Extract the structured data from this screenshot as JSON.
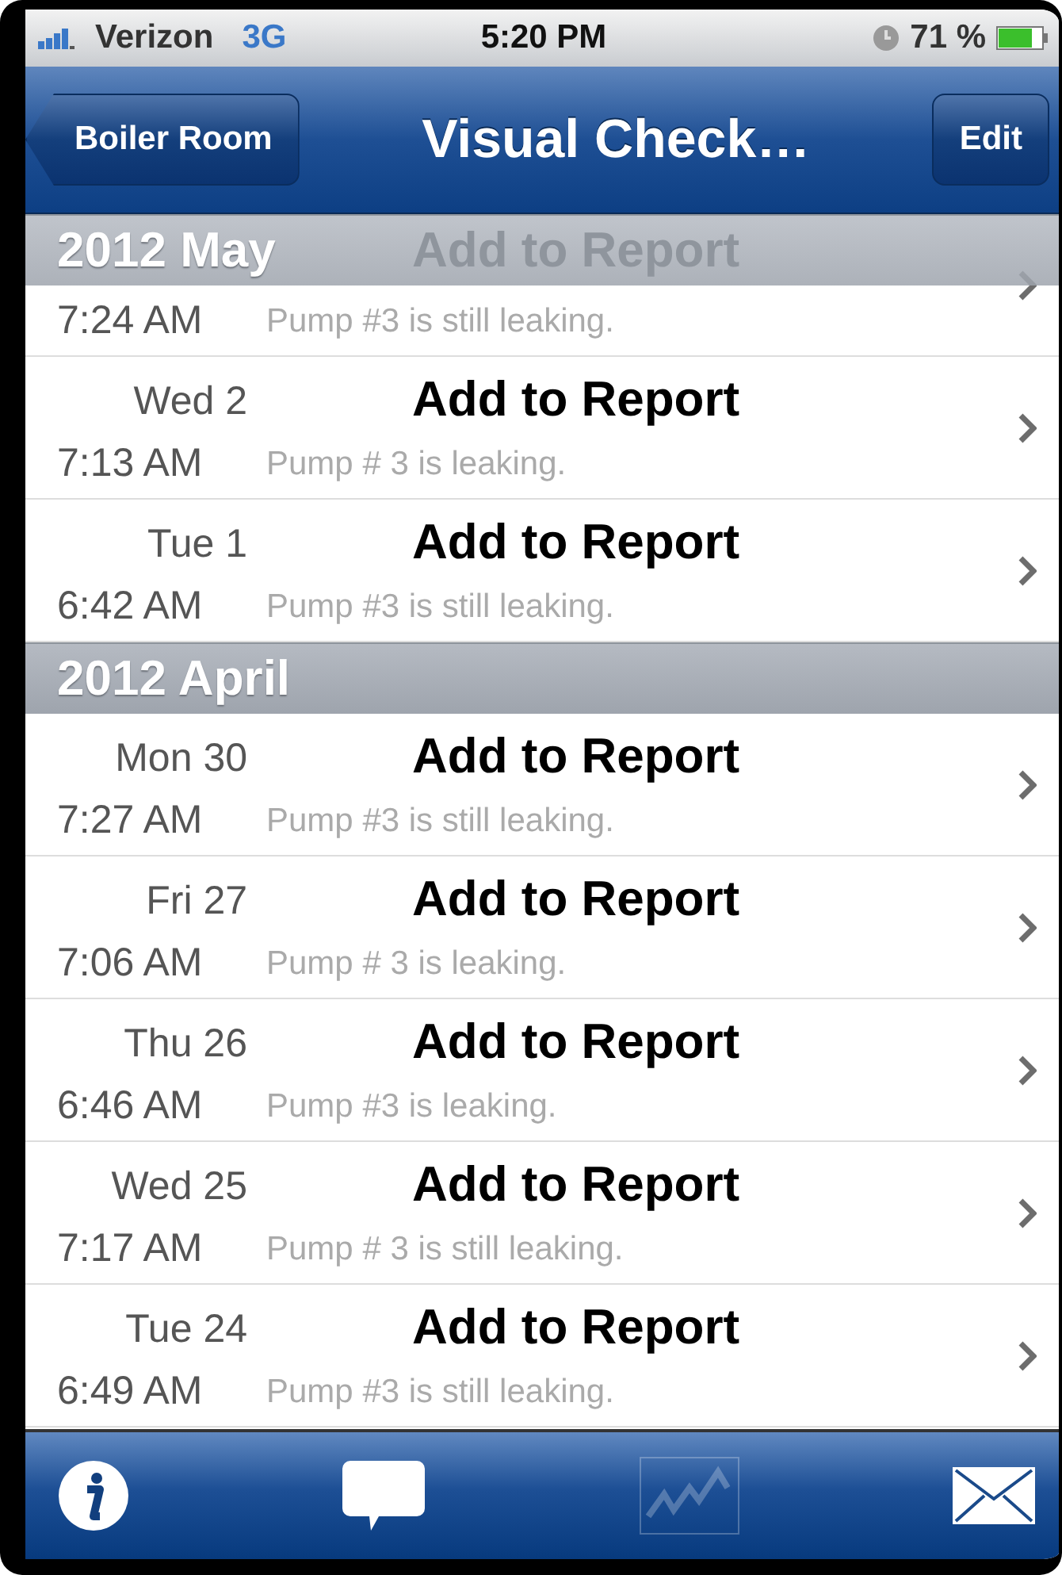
{
  "status_bar": {
    "carrier": "Verizon",
    "network": "3G",
    "time": "5:20 PM",
    "battery": "71 %"
  },
  "nav_bar": {
    "back": "Boiler Room",
    "title": "Visual Check…",
    "action": "Edit"
  },
  "sections": [
    {
      "title": "2012 May",
      "rows": [
        {
          "time": "7:24 AM",
          "title": "Add to Report",
          "note": "Pump #3 is still leaking."
        },
        {
          "day": "Wed 2",
          "time": "7:13 AM",
          "title": "Add to Report",
          "note": "Pump # 3 is leaking."
        },
        {
          "day": "Tue 1",
          "time": "6:42 AM",
          "title": "Add to Report",
          "note": "Pump #3 is still leaking."
        }
      ]
    },
    {
      "title": "2012 April",
      "rows": [
        {
          "day": "Mon 30",
          "time": "7:27 AM",
          "title": "Add to Report",
          "note": "Pump #3 is still leaking."
        },
        {
          "day": "Fri 27",
          "time": "7:06 AM",
          "title": "Add to Report",
          "note": "Pump # 3 is leaking."
        },
        {
          "day": "Thu 26",
          "time": "6:46 AM",
          "title": "Add to Report",
          "note": "Pump #3 is leaking."
        },
        {
          "day": "Wed 25",
          "time": "7:17 AM",
          "title": "Add to Report",
          "note": "Pump # 3 is still leaking."
        },
        {
          "day": "Tue 24",
          "time": "6:49 AM",
          "title": "Add to Report",
          "note": "Pump #3 is still leaking."
        }
      ]
    }
  ],
  "tab_bar": [
    {
      "kind": "info",
      "disabled": false
    },
    {
      "kind": "comment",
      "disabled": false
    },
    {
      "kind": "chart",
      "disabled": true
    },
    {
      "kind": "mail",
      "disabled": false
    }
  ]
}
